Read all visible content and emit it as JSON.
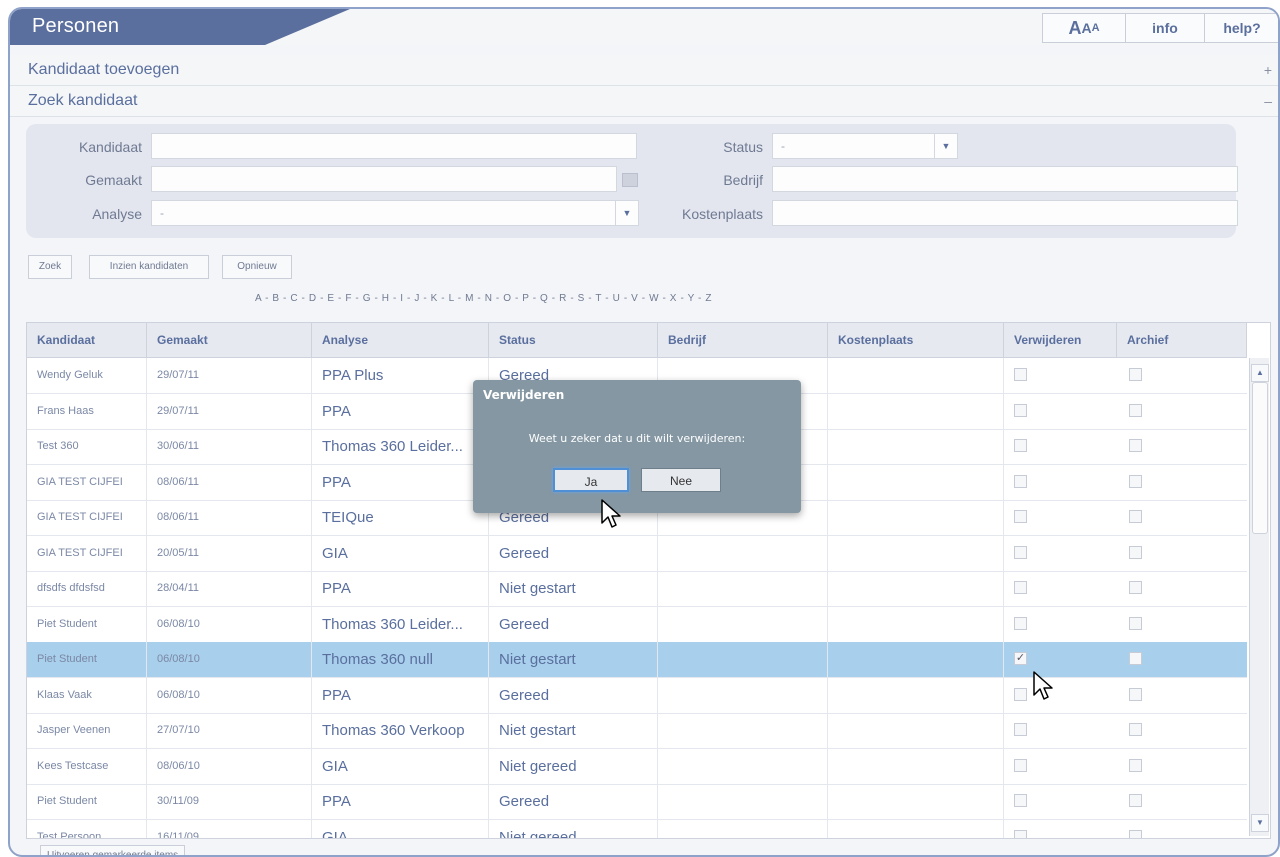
{
  "app": {
    "title": "Personen",
    "font_size_label": "AAA",
    "info_label": "info",
    "help_label": "help?"
  },
  "sections": {
    "add_candidate": {
      "label": "Kandidaat toevoegen",
      "sign": "+"
    },
    "search_candidate": {
      "label": "Zoek kandidaat",
      "sign": "–"
    }
  },
  "search": {
    "kandidaat_label": "Kandidaat",
    "kandidaat_value": "",
    "gemaakt_label": "Gemaakt",
    "gemaakt_value": "",
    "analyse_label": "Analyse",
    "analyse_value": "-",
    "status_label": "Status",
    "status_value": "-",
    "bedrijf_label": "Bedrijf",
    "bedrijf_value": "",
    "kostenplaats_label": "Kostenplaats",
    "kostenplaats_value": ""
  },
  "actions": {
    "zoek": "Zoek",
    "inzien": "Inzien kandidaten",
    "opnieuw": "Opnieuw"
  },
  "alphabet": "A - B - C - D - E - F - G - H - I - J - K - L - M - N - O - P - Q - R - S - T - U - V - W - X - Y - Z",
  "table": {
    "columns": [
      "Kandidaat",
      "Gemaakt",
      "Analyse",
      "Status",
      "Bedrijf",
      "Kostenplaats",
      "Verwijderen",
      "Archief"
    ],
    "rows": [
      {
        "kandidaat": "Wendy Geluk",
        "gemaakt": "29/07/11",
        "analyse": "PPA Plus",
        "status": "Gereed",
        "verwijderen": false,
        "selected": false
      },
      {
        "kandidaat": "Frans Haas",
        "gemaakt": "29/07/11",
        "analyse": "PPA",
        "status": "",
        "verwijderen": false,
        "selected": false
      },
      {
        "kandidaat": "Test 360",
        "gemaakt": "30/06/11",
        "analyse": "Thomas 360 Leider...",
        "status": "",
        "verwijderen": false,
        "selected": false
      },
      {
        "kandidaat": "GIA TEST CIJFEI",
        "gemaakt": "08/06/11",
        "analyse": "PPA",
        "status": "",
        "verwijderen": false,
        "selected": false
      },
      {
        "kandidaat": "GIA TEST CIJFEI",
        "gemaakt": "08/06/11",
        "analyse": "TEIQue",
        "status": "Gereed",
        "verwijderen": false,
        "selected": false
      },
      {
        "kandidaat": "GIA TEST CIJFEI",
        "gemaakt": "20/05/11",
        "analyse": "GIA",
        "status": "Gereed",
        "verwijderen": false,
        "selected": false
      },
      {
        "kandidaat": "dfsdfs dfdsfsd",
        "gemaakt": "28/04/11",
        "analyse": "PPA",
        "status": "Niet gestart",
        "verwijderen": false,
        "selected": false
      },
      {
        "kandidaat": "Piet Student",
        "gemaakt": "06/08/10",
        "analyse": "Thomas 360 Leider...",
        "status": "Gereed",
        "verwijderen": false,
        "selected": false
      },
      {
        "kandidaat": "Piet Student",
        "gemaakt": "06/08/10",
        "analyse": "Thomas 360 null",
        "status": "Niet gestart",
        "verwijderen": true,
        "selected": true
      },
      {
        "kandidaat": "Klaas Vaak",
        "gemaakt": "06/08/10",
        "analyse": "PPA",
        "status": "Gereed",
        "verwijderen": false,
        "selected": false
      },
      {
        "kandidaat": "Jasper Veenen",
        "gemaakt": "27/07/10",
        "analyse": "Thomas 360 Verkoop",
        "status": "Niet gestart",
        "verwijderen": false,
        "selected": false
      },
      {
        "kandidaat": "Kees Testcase",
        "gemaakt": "08/06/10",
        "analyse": "GIA",
        "status": "Niet gereed",
        "verwijderen": false,
        "selected": false
      },
      {
        "kandidaat": "Piet Student",
        "gemaakt": "30/11/09",
        "analyse": "PPA",
        "status": "Gereed",
        "verwijderen": false,
        "selected": false
      },
      {
        "kandidaat": "Test Persoon",
        "gemaakt": "16/11/09",
        "analyse": "GIA",
        "status": "Niet gereed",
        "verwijderen": false,
        "selected": false
      }
    ]
  },
  "footer": {
    "execute_label": "Uitvoeren gemarkeerde items"
  },
  "dialog": {
    "title": "Verwijderen",
    "message": "Weet u zeker dat u dit wilt verwijderen:",
    "yes": "Ja",
    "no": "Nee"
  },
  "colors": {
    "accent": "#5a6f9e",
    "selected_row": "#a8cfeb",
    "dialog_bg": "#8497a3",
    "focus": "#4f8fd6"
  }
}
